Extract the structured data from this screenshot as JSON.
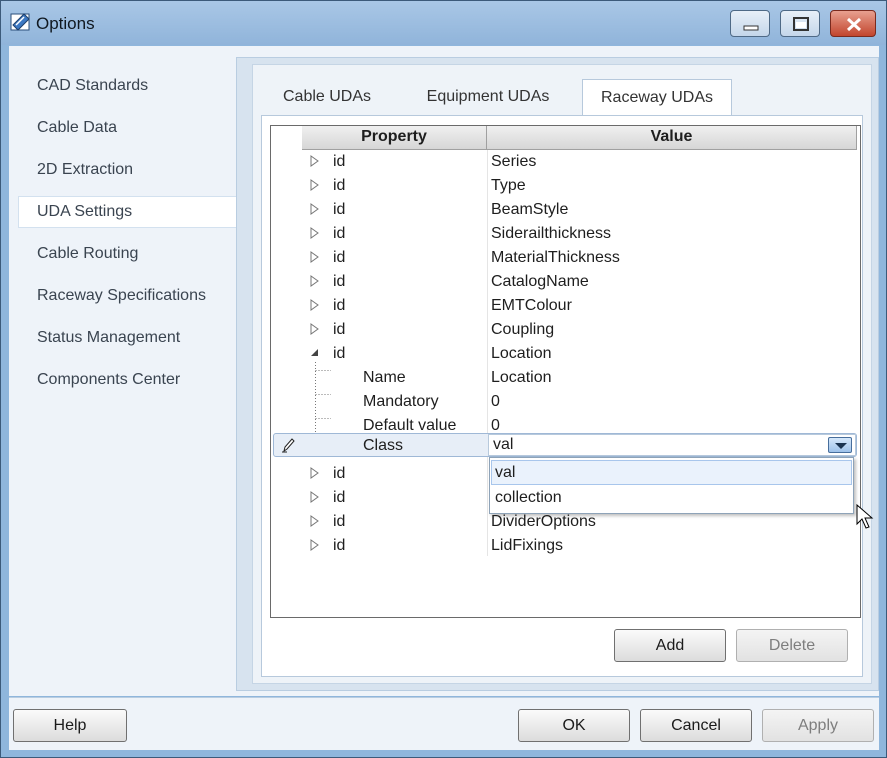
{
  "window": {
    "title": "Options",
    "app_icon": "options-app-icon"
  },
  "caption_buttons": {
    "minimize": "minimize-icon",
    "maximize": "maximize-icon",
    "close": "close-icon"
  },
  "nav": {
    "items": [
      {
        "label": "CAD Standards"
      },
      {
        "label": "Cable Data"
      },
      {
        "label": "2D Extraction"
      },
      {
        "label": "UDA Settings",
        "selected": true
      },
      {
        "label": "Cable Routing"
      },
      {
        "label": "Raceway Specifications"
      },
      {
        "label": "Status Management"
      },
      {
        "label": "Components Center"
      }
    ]
  },
  "tabs": [
    {
      "label": "Cable UDAs"
    },
    {
      "label": "Equipment UDAs"
    },
    {
      "label": "Raceway UDAs",
      "active": true
    }
  ],
  "grid": {
    "columns": {
      "property": "Property",
      "value": "Value"
    },
    "rows": [
      {
        "property": "id",
        "value": "Series",
        "expanded": false
      },
      {
        "property": "id",
        "value": "Type",
        "expanded": false
      },
      {
        "property": "id",
        "value": "BeamStyle",
        "expanded": false
      },
      {
        "property": "id",
        "value": "Siderailthickness",
        "expanded": false
      },
      {
        "property": "id",
        "value": "MaterialThickness",
        "expanded": false
      },
      {
        "property": "id",
        "value": "CatalogName",
        "expanded": false
      },
      {
        "property": "id",
        "value": "EMTColour",
        "expanded": false
      },
      {
        "property": "id",
        "value": "Coupling",
        "expanded": false
      },
      {
        "property": "id",
        "value": "Location",
        "expanded": true
      }
    ],
    "children": [
      {
        "property": "Name",
        "value": "Location"
      },
      {
        "property": "Mandatory",
        "value": "0"
      },
      {
        "property": "Default value",
        "value": "0"
      },
      {
        "property": "Class",
        "value": "val",
        "editing": true
      }
    ],
    "rows_after": [
      {
        "property": "id",
        "value": ""
      },
      {
        "property": "id",
        "value": ""
      },
      {
        "property": "id",
        "value": "DividerOptions"
      },
      {
        "property": "id",
        "value": "LidFixings"
      }
    ],
    "dropdown_options": [
      "val",
      "collection"
    ],
    "selected_option": "val"
  },
  "grid_buttons": {
    "add": "Add",
    "delete": "Delete"
  },
  "footer": {
    "help": "Help",
    "ok": "OK",
    "cancel": "Cancel",
    "apply": "Apply"
  },
  "colors": {
    "title_bar": "#a9c7e6",
    "close_button": "#c2452d",
    "selection": "#eaf2fc"
  }
}
